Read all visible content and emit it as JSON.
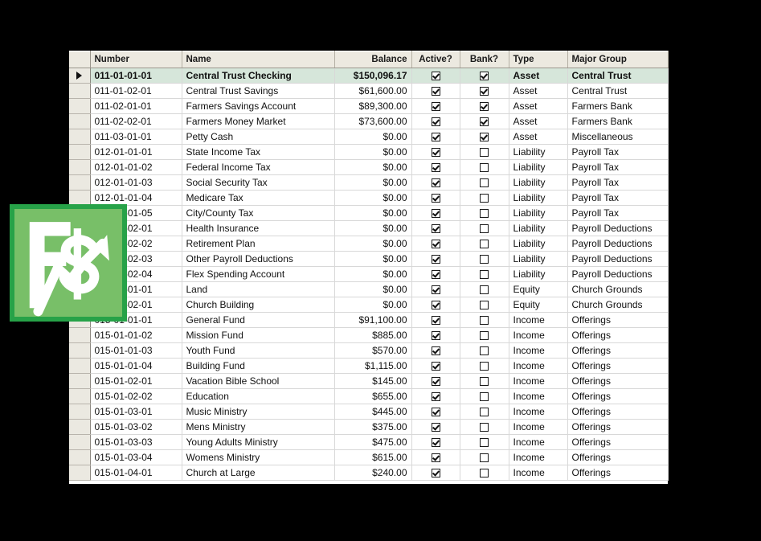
{
  "grid": {
    "columns": [
      {
        "key": "selector",
        "label": ""
      },
      {
        "key": "number",
        "label": "Number"
      },
      {
        "key": "name",
        "label": "Name"
      },
      {
        "key": "balance",
        "label": "Balance"
      },
      {
        "key": "active",
        "label": "Active?"
      },
      {
        "key": "bank",
        "label": "Bank?"
      },
      {
        "key": "type",
        "label": "Type"
      },
      {
        "key": "major_group",
        "label": "Major Group"
      }
    ],
    "selected_row_index": 0,
    "rows": [
      {
        "number": "011-01-01-01",
        "name": "Central Trust Checking",
        "balance": "$150,096.17",
        "active": true,
        "bank": true,
        "type": "Asset",
        "major_group": "Central Trust"
      },
      {
        "number": "011-01-02-01",
        "name": "Central Trust Savings",
        "balance": "$61,600.00",
        "active": true,
        "bank": true,
        "type": "Asset",
        "major_group": "Central Trust"
      },
      {
        "number": "011-02-01-01",
        "name": "Farmers Savings Account",
        "balance": "$89,300.00",
        "active": true,
        "bank": true,
        "type": "Asset",
        "major_group": "Farmers Bank"
      },
      {
        "number": "011-02-02-01",
        "name": "Farmers Money Market",
        "balance": "$73,600.00",
        "active": true,
        "bank": true,
        "type": "Asset",
        "major_group": "Farmers Bank"
      },
      {
        "number": "011-03-01-01",
        "name": "Petty Cash",
        "balance": "$0.00",
        "active": true,
        "bank": true,
        "type": "Asset",
        "major_group": "Miscellaneous"
      },
      {
        "number": "012-01-01-01",
        "name": "State Income Tax",
        "balance": "$0.00",
        "active": true,
        "bank": false,
        "type": "Liability",
        "major_group": "Payroll Tax"
      },
      {
        "number": "012-01-01-02",
        "name": "Federal Income Tax",
        "balance": "$0.00",
        "active": true,
        "bank": false,
        "type": "Liability",
        "major_group": "Payroll Tax"
      },
      {
        "number": "012-01-01-03",
        "name": "Social Security Tax",
        "balance": "$0.00",
        "active": true,
        "bank": false,
        "type": "Liability",
        "major_group": "Payroll Tax"
      },
      {
        "number": "012-01-01-04",
        "name": "Medicare Tax",
        "balance": "$0.00",
        "active": true,
        "bank": false,
        "type": "Liability",
        "major_group": "Payroll Tax"
      },
      {
        "number": "012-01-01-05",
        "name": "City/County Tax",
        "balance": "$0.00",
        "active": true,
        "bank": false,
        "type": "Liability",
        "major_group": "Payroll Tax"
      },
      {
        "number": "012-01-02-01",
        "name": "Health Insurance",
        "balance": "$0.00",
        "active": true,
        "bank": false,
        "type": "Liability",
        "major_group": "Payroll Deductions"
      },
      {
        "number": "012-01-02-02",
        "name": "Retirement Plan",
        "balance": "$0.00",
        "active": true,
        "bank": false,
        "type": "Liability",
        "major_group": "Payroll Deductions"
      },
      {
        "number": "012-01-02-03",
        "name": "Other Payroll Deductions",
        "balance": "$0.00",
        "active": true,
        "bank": false,
        "type": "Liability",
        "major_group": "Payroll Deductions"
      },
      {
        "number": "012-01-02-04",
        "name": "Flex Spending Account",
        "balance": "$0.00",
        "active": true,
        "bank": false,
        "type": "Liability",
        "major_group": "Payroll Deductions"
      },
      {
        "number": "013-01-01-01",
        "name": "Land",
        "balance": "$0.00",
        "active": true,
        "bank": false,
        "type": "Equity",
        "major_group": "Church Grounds"
      },
      {
        "number": "013-01-02-01",
        "name": "Church Building",
        "balance": "$0.00",
        "active": true,
        "bank": false,
        "type": "Equity",
        "major_group": "Church Grounds"
      },
      {
        "number": "015-01-01-01",
        "name": "General Fund",
        "balance": "$91,100.00",
        "active": true,
        "bank": false,
        "type": "Income",
        "major_group": "Offerings"
      },
      {
        "number": "015-01-01-02",
        "name": "Mission Fund",
        "balance": "$885.00",
        "active": true,
        "bank": false,
        "type": "Income",
        "major_group": "Offerings"
      },
      {
        "number": "015-01-01-03",
        "name": "Youth Fund",
        "balance": "$570.00",
        "active": true,
        "bank": false,
        "type": "Income",
        "major_group": "Offerings"
      },
      {
        "number": "015-01-01-04",
        "name": "Building Fund",
        "balance": "$1,115.00",
        "active": true,
        "bank": false,
        "type": "Income",
        "major_group": "Offerings"
      },
      {
        "number": "015-01-02-01",
        "name": "Vacation Bible School",
        "balance": "$145.00",
        "active": true,
        "bank": false,
        "type": "Income",
        "major_group": "Offerings"
      },
      {
        "number": "015-01-02-02",
        "name": "Education",
        "balance": "$655.00",
        "active": true,
        "bank": false,
        "type": "Income",
        "major_group": "Offerings"
      },
      {
        "number": "015-01-03-01",
        "name": "Music Ministry",
        "balance": "$445.00",
        "active": true,
        "bank": false,
        "type": "Income",
        "major_group": "Offerings"
      },
      {
        "number": "015-01-03-02",
        "name": "Mens Ministry",
        "balance": "$375.00",
        "active": true,
        "bank": false,
        "type": "Income",
        "major_group": "Offerings"
      },
      {
        "number": "015-01-03-03",
        "name": "Young Adults Ministry",
        "balance": "$475.00",
        "active": true,
        "bank": false,
        "type": "Income",
        "major_group": "Offerings"
      },
      {
        "number": "015-01-03-04",
        "name": "Womens Ministry",
        "balance": "$615.00",
        "active": true,
        "bank": false,
        "type": "Income",
        "major_group": "Offerings"
      },
      {
        "number": "015-01-04-01",
        "name": "Church at Large",
        "balance": "$240.00",
        "active": true,
        "bank": false,
        "type": "Income",
        "major_group": "Offerings"
      }
    ]
  },
  "logo": {
    "name": "finance-logo",
    "letter": "F",
    "symbol": "dollar-sign-with-up-arrow",
    "border_color": "#27a248",
    "fill_color": "#78bf68",
    "mark_color": "#ffffff"
  },
  "theme": {
    "background": "#000000",
    "header_background": "#ece9e0",
    "selected_row_background": "#d6e6da",
    "row_background": "#ffffff",
    "grid_line": "#d8d8d8"
  }
}
